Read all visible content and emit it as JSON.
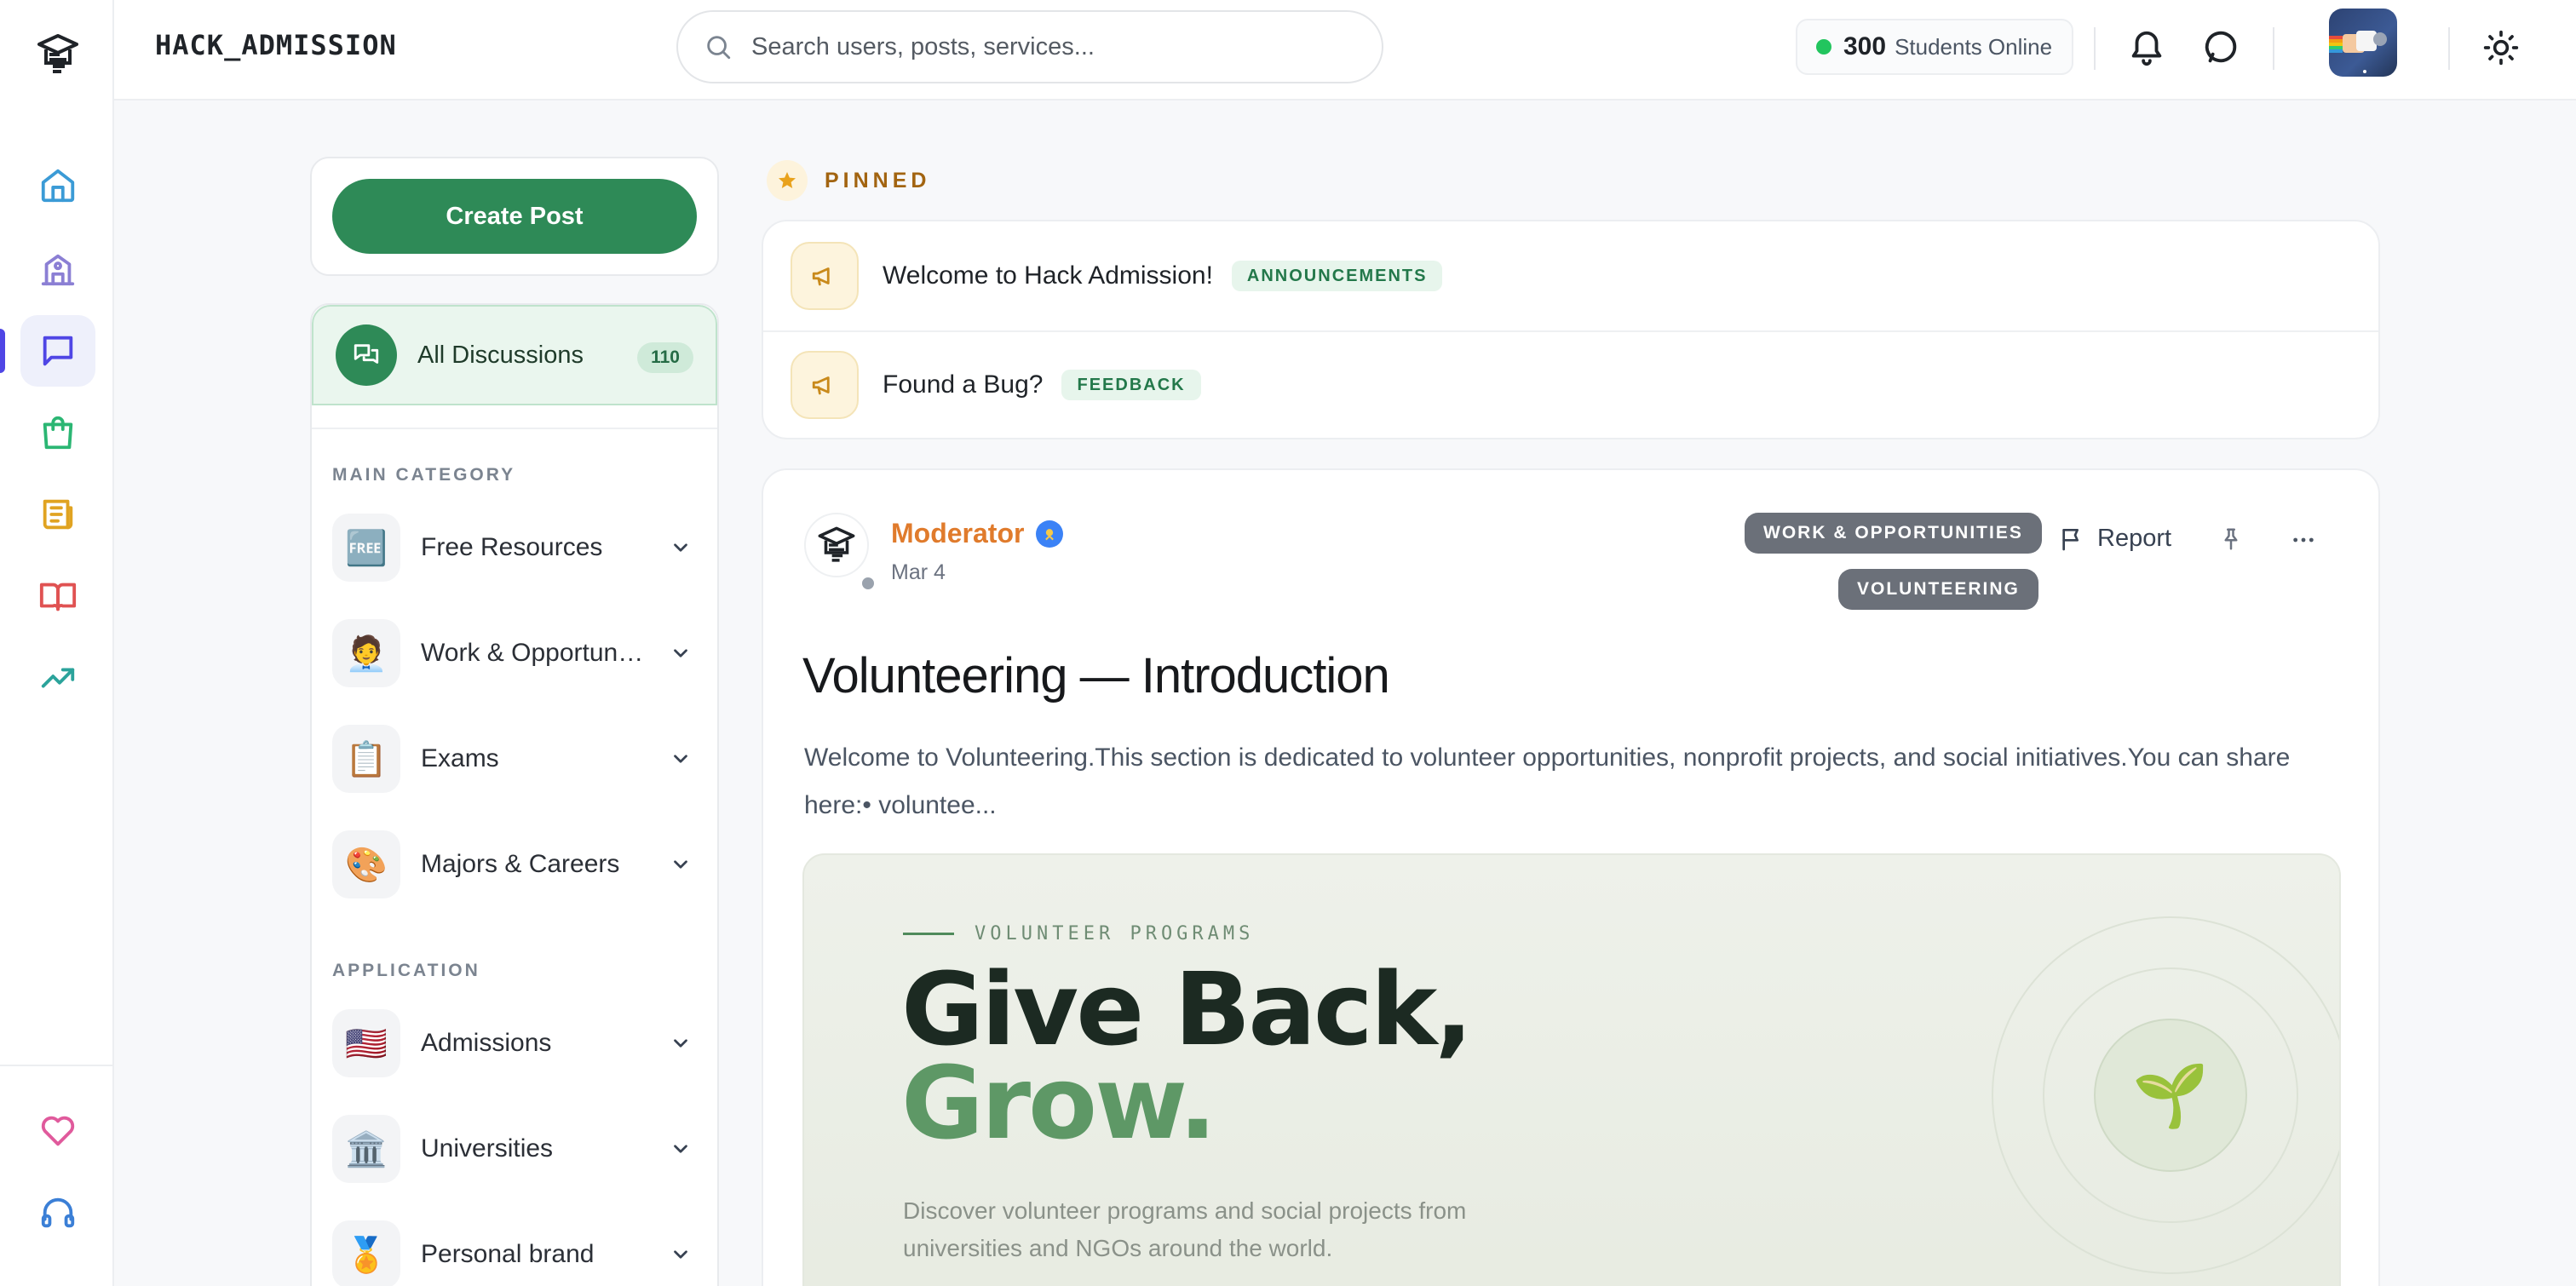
{
  "app": {
    "brand": "HACK_ADMISSION"
  },
  "search": {
    "placeholder": "Search users, posts, services..."
  },
  "presence": {
    "count": "300",
    "label": "Students Online"
  },
  "rail": {
    "items": [
      {
        "name": "home",
        "icon": "home-icon",
        "color": "#3b9bd6"
      },
      {
        "name": "universities",
        "icon": "building-icon",
        "color": "#8b7fd4"
      },
      {
        "name": "discussions",
        "icon": "chat-icon",
        "color": "#4f46e5",
        "active": true
      },
      {
        "name": "shop",
        "icon": "shopping-bag-icon",
        "color": "#2bb673"
      },
      {
        "name": "news",
        "icon": "newspaper-icon",
        "color": "#e0a321"
      },
      {
        "name": "library",
        "icon": "book-icon",
        "color": "#e05252"
      },
      {
        "name": "trends",
        "icon": "trending-up-icon",
        "color": "#2ba39b"
      }
    ],
    "bottom": [
      {
        "name": "favorites",
        "icon": "heart-icon",
        "color": "#e05a9c"
      },
      {
        "name": "support",
        "icon": "headphones-icon",
        "color": "#3b7fd6"
      }
    ]
  },
  "sidebar": {
    "create_label": "Create Post",
    "all_discussions": {
      "label": "All Discussions",
      "count": "110"
    },
    "main_category_label": "MAIN CATEGORY",
    "main_category": [
      {
        "label": "Free Resources",
        "icon": "free-badge-icon",
        "emoji": "🆓"
      },
      {
        "label": "Work & Opportunities",
        "icon": "worker-icon",
        "emoji": "🧑‍💼"
      },
      {
        "label": "Exams",
        "icon": "checklist-icon",
        "emoji": "📋"
      },
      {
        "label": "Majors & Careers",
        "icon": "palette-icon",
        "emoji": "🎨"
      }
    ],
    "application_label": "APPLICATION",
    "application": [
      {
        "label": "Admissions",
        "icon": "us-flag-icon",
        "emoji": "🇺🇸"
      },
      {
        "label": "Universities",
        "icon": "university-icon",
        "emoji": "🏛️"
      },
      {
        "label": "Personal brand",
        "icon": "medal-icon",
        "emoji": "🏅"
      }
    ]
  },
  "pinned": {
    "label": "PINNED",
    "items": [
      {
        "title": "Welcome to Hack Admission!",
        "tag": "ANNOUNCEMENTS"
      },
      {
        "title": "Found a Bug?",
        "tag": "FEEDBACK"
      }
    ]
  },
  "post": {
    "author": "Moderator",
    "date": "Mar 4",
    "tags": [
      "WORK & OPPORTUNITIES",
      "VOLUNTEERING"
    ],
    "report_label": "Report",
    "title": "Volunteering — Introduction",
    "excerpt": "Welcome to Volunteering.This section is dedicated to volunteer opportunities, nonprofit projects, and social initiatives.You can share here:• voluntee...",
    "banner": {
      "kicker": "VOLUNTEER PROGRAMS",
      "headline_1": "Give Back,",
      "headline_2": "Grow.",
      "subtitle": "Discover volunteer programs and social projects from universities and NGOs around the world.",
      "emoji": "🌱"
    }
  },
  "colors": {
    "accent": "#2e8a57",
    "author": "#e07b2c",
    "pinned": "#a26410"
  }
}
